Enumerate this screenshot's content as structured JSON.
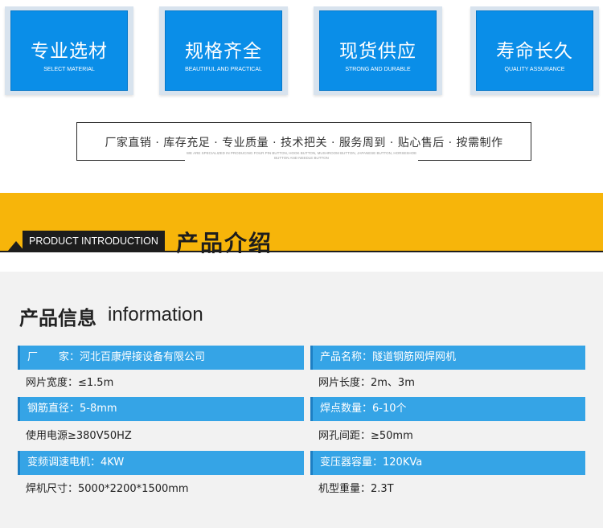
{
  "features": [
    {
      "title": "专业选材",
      "subtitle": "SELECT MATERIAL"
    },
    {
      "title": "规格齐全",
      "subtitle": "BEAUTIFUL AND PRACTICAL"
    },
    {
      "title": "现货供应",
      "subtitle": "STRONG AND DURABLE"
    },
    {
      "title": "寿命长久",
      "subtitle": "QUALITY ASSURANCE"
    }
  ],
  "slogan": {
    "text": "厂家直销 · 库存充足 · 专业质量 · 技术把关 · 服务周到 · 贴心售后 · 按需制作",
    "small": "WE ARE SPECIALIZED IN PRODUCING FOUR PIN BUTTON, HOOK BUTTON, MUSHROOM BUTTON, JAPANESE BUTTON, HORSESHOE BUTTON AND NEEDLE BUTTON"
  },
  "banner": {
    "label": "PRODUCT INTRODUCTION",
    "title": "产品介绍"
  },
  "info": {
    "heading": "产品信息",
    "heading_en": "information",
    "rows": [
      {
        "left": "厂　　家：河北百康焊接设备有限公司",
        "right": "产品名称：隧道钢筋网焊网机"
      },
      {
        "left": "网片宽度：≤1.5m",
        "right": "网片长度：2m、3m"
      },
      {
        "left": "钢筋直径：5-8mm",
        "right": "焊点数量：6-10个"
      },
      {
        "left": "使用电源≥380V50HZ",
        "right": "网孔间距：≥50mm"
      },
      {
        "left": "变频调速电机：4KW",
        "right": "变压器容量：120KVa"
      },
      {
        "left": "焊机尺寸：5000*2200*1500mm",
        "right": "机型重量：2.3T"
      }
    ]
  },
  "colors": {
    "card_blue": "#0a8ee8",
    "row_blue": "#35a4e6",
    "banner_yellow": "#f7b50a",
    "dark": "#1d1d1d"
  }
}
